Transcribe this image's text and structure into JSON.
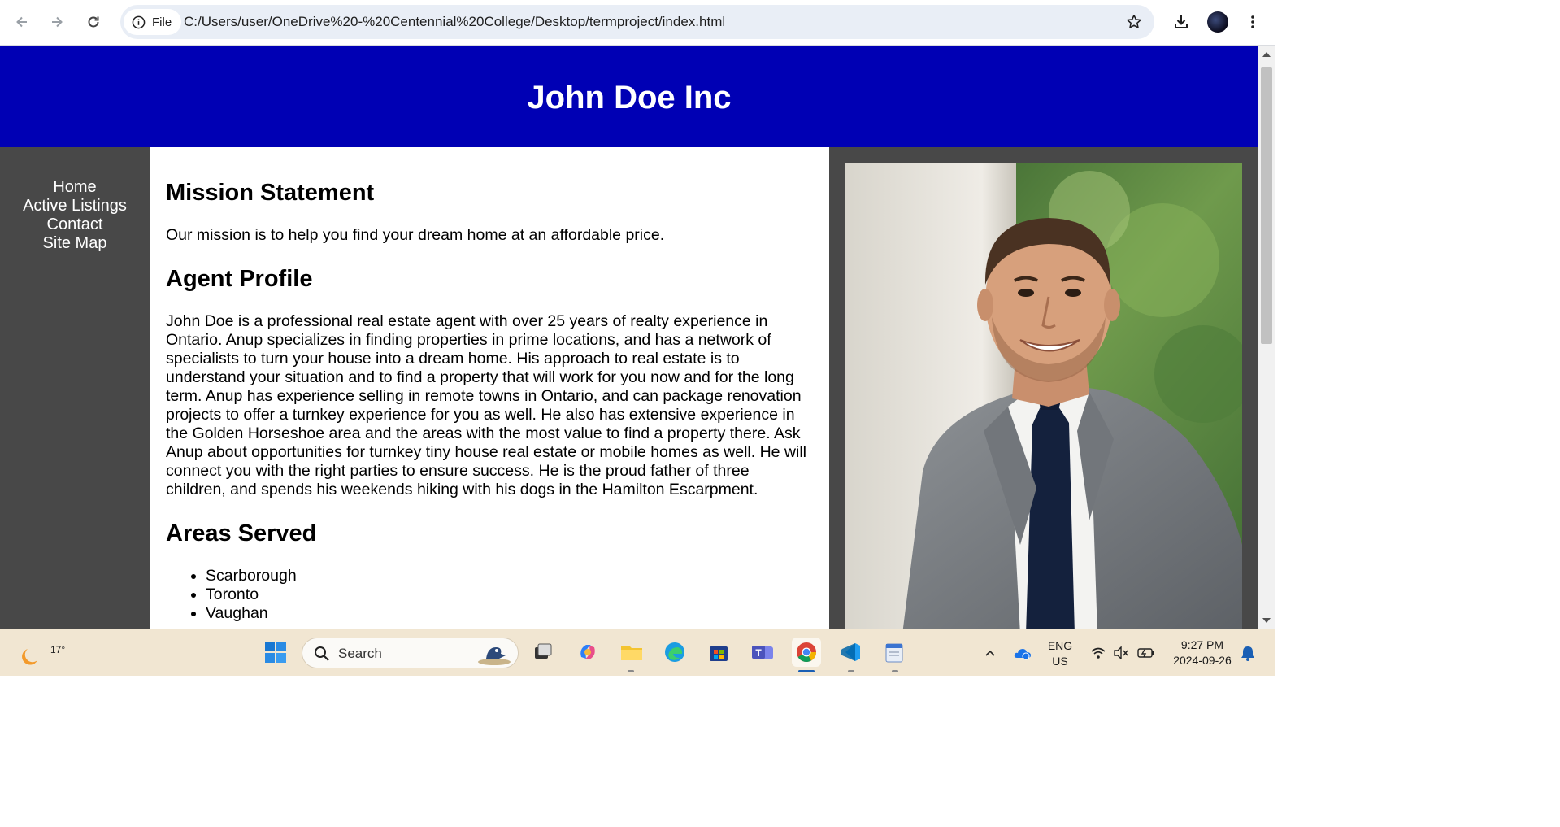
{
  "browser": {
    "site_info_label": "File",
    "url": "C:/Users/user/OneDrive%20-%20Centennial%20College/Desktop/termproject/index.html"
  },
  "site": {
    "title": "John Doe Inc",
    "nav": [
      "Home",
      "Active Listings",
      "Contact",
      "Site Map"
    ],
    "mission_heading": "Mission Statement",
    "mission_text": "Our mission is to help you find your dream home at an affordable price.",
    "profile_heading": "Agent Profile",
    "profile_text": "John Doe is a professional real estate agent with over 25 years of realty experience in Ontario. Anup specializes in finding properties in prime locations, and has a network of specialists to turn your house into a dream home. His approach to real estate is to understand your situation and to find a property that will work for you now and for the long term. Anup has experience selling in remote towns in Ontario, and can package renovation projects to offer a turnkey experience for you as well. He also has extensive experience in the Golden Horseshoe area and the areas with the most value to find a property there. Ask Anup about opportunities for turnkey tiny house real estate or mobile homes as well. He will connect you with the right parties to ensure success. He is the proud father of three children, and spends his weekends hiking with his dogs in the Hamilton Escarpment.",
    "areas_heading": "Areas Served",
    "areas": [
      "Scarborough",
      "Toronto",
      "Vaughan"
    ]
  },
  "taskbar": {
    "temperature": "17°",
    "search_label": "Search",
    "lang_line1": "ENG",
    "lang_line2": "US",
    "time": "9:27 PM",
    "date": "2024-09-26"
  },
  "colors": {
    "header_bg": "#0000b4",
    "nav_bg": "#484848"
  }
}
